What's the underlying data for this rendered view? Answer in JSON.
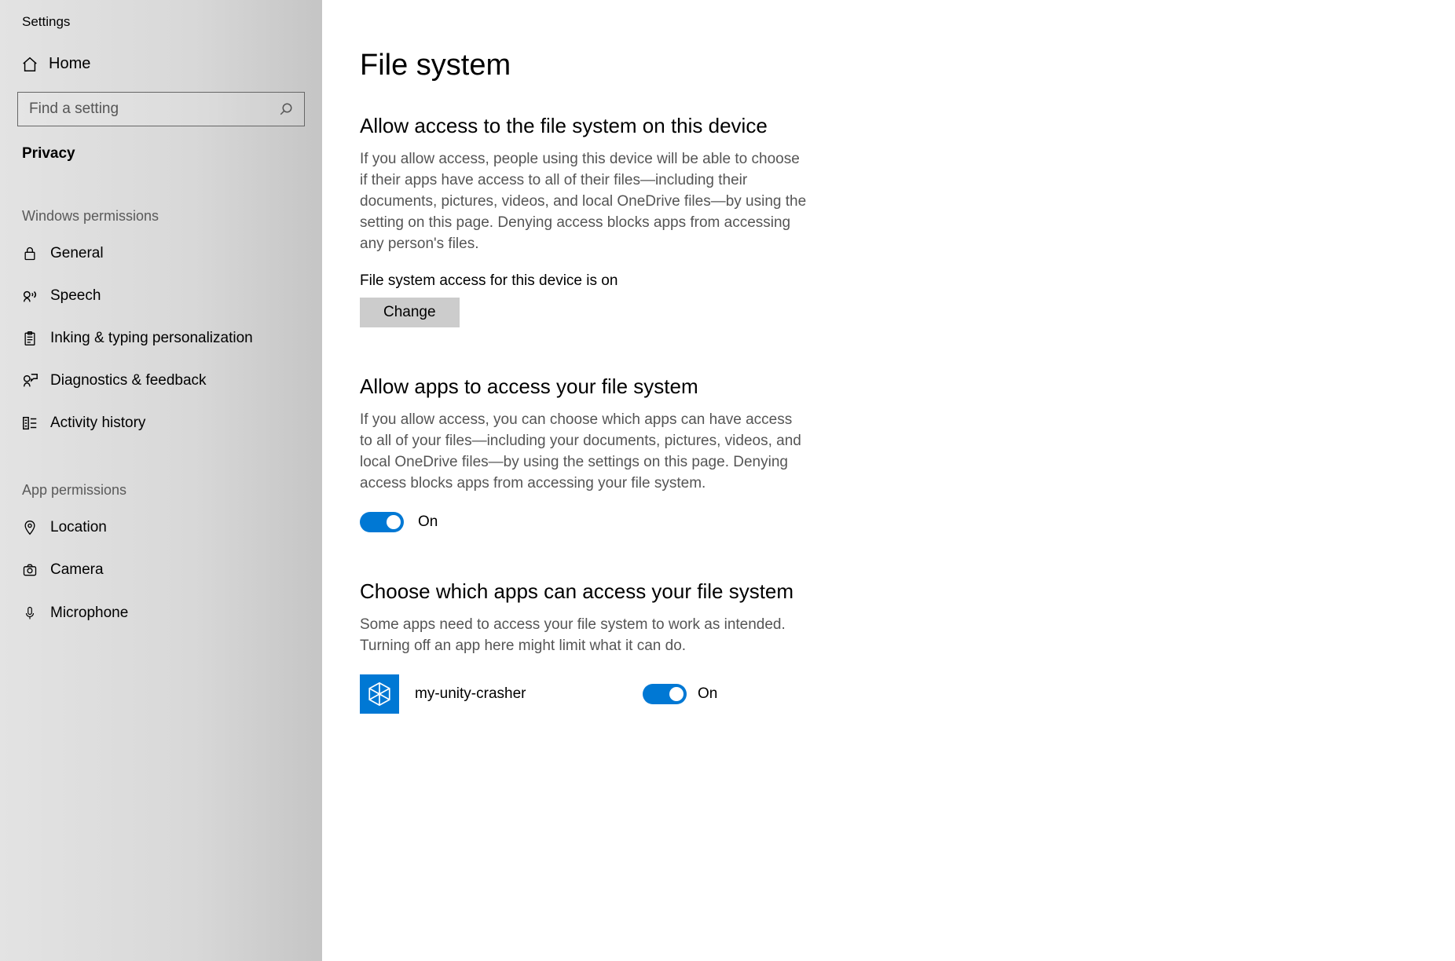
{
  "window_title": "Settings",
  "sidebar": {
    "home_label": "Home",
    "search_placeholder": "Find a setting",
    "current_section": "Privacy",
    "group1_header": "Windows permissions",
    "group1_items": [
      {
        "label": "General"
      },
      {
        "label": "Speech"
      },
      {
        "label": "Inking & typing personalization"
      },
      {
        "label": "Diagnostics & feedback"
      },
      {
        "label": "Activity history"
      }
    ],
    "group2_header": "App permissions",
    "group2_items": [
      {
        "label": "Location"
      },
      {
        "label": "Camera"
      },
      {
        "label": "Microphone"
      }
    ]
  },
  "main": {
    "page_title": "File system",
    "section1": {
      "title": "Allow access to the file system on this device",
      "desc": "If you allow access, people using this device will be able to choose if their apps have access to all of their files—including their documents, pictures, videos, and local OneDrive files—by using the setting on this page. Denying access blocks apps from accessing any person's files.",
      "status": "File system access for this device is on",
      "change_label": "Change"
    },
    "section2": {
      "title": "Allow apps to access your file system",
      "desc": "If you allow access, you can choose which apps can have access to all of your files—including your documents, pictures, videos, and local OneDrive files—by using the settings on this page. Denying access blocks apps from accessing your file system.",
      "toggle_state": "On"
    },
    "section3": {
      "title": "Choose which apps can access your file system",
      "desc": "Some apps need to access your file system to work as intended. Turning off an app here might limit what it can do.",
      "apps": [
        {
          "name": "my-unity-crasher",
          "state": "On"
        }
      ]
    }
  }
}
